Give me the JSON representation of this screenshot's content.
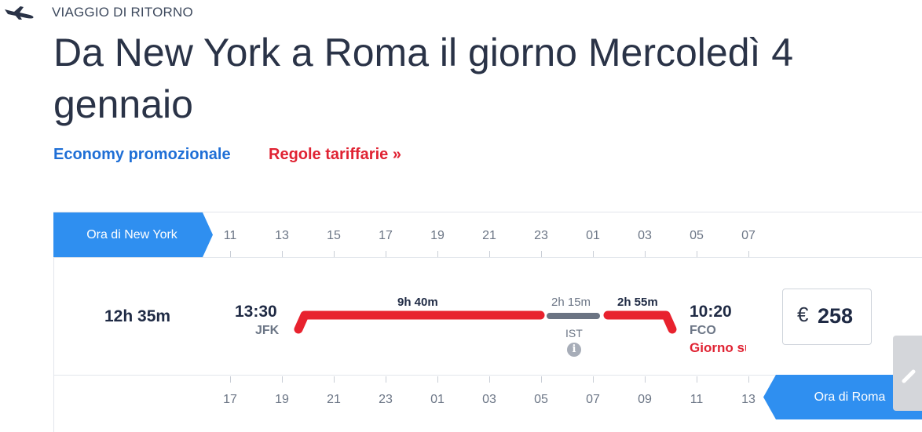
{
  "trip": {
    "label": "VIAGGIO DI RITORNO",
    "title": "Da New York a Roma il giorno Mercoledì 4 gennaio",
    "fare_class": "Economy promozionale",
    "fare_rules": "Regole tariffarie »"
  },
  "timeline": {
    "origin_tz_label": "Ora di New York",
    "dest_tz_label": "Ora di Roma",
    "origin_ticks": [
      "11",
      "13",
      "15",
      "17",
      "19",
      "21",
      "23",
      "01",
      "03",
      "05",
      "07"
    ],
    "dest_ticks": [
      "17",
      "19",
      "21",
      "23",
      "01",
      "03",
      "05",
      "07",
      "09",
      "11",
      "13"
    ]
  },
  "flight": {
    "total_duration": "12h 35m",
    "departure_time": "13:30",
    "departure_airport": "JFK",
    "arrival_time": "10:20",
    "arrival_airport": "FCO",
    "arrival_day_note": "Giorno successivo",
    "segment1_duration": "9h 40m",
    "layover_duration": "2h 15m",
    "layover_airport": "IST",
    "segment2_duration": "2h 55m",
    "info_icon": "i"
  },
  "price": {
    "currency": "€",
    "amount": "258"
  },
  "colors": {
    "accent_blue": "#2f8ff0",
    "segment_red": "#e8222e",
    "layover_gray": "#6b7483",
    "link_blue": "#1f6fd6",
    "link_red": "#e02333"
  },
  "icons": {
    "plane": "airplane-landing-icon",
    "info": "info-icon",
    "scroll": "chevron-right-icon"
  }
}
